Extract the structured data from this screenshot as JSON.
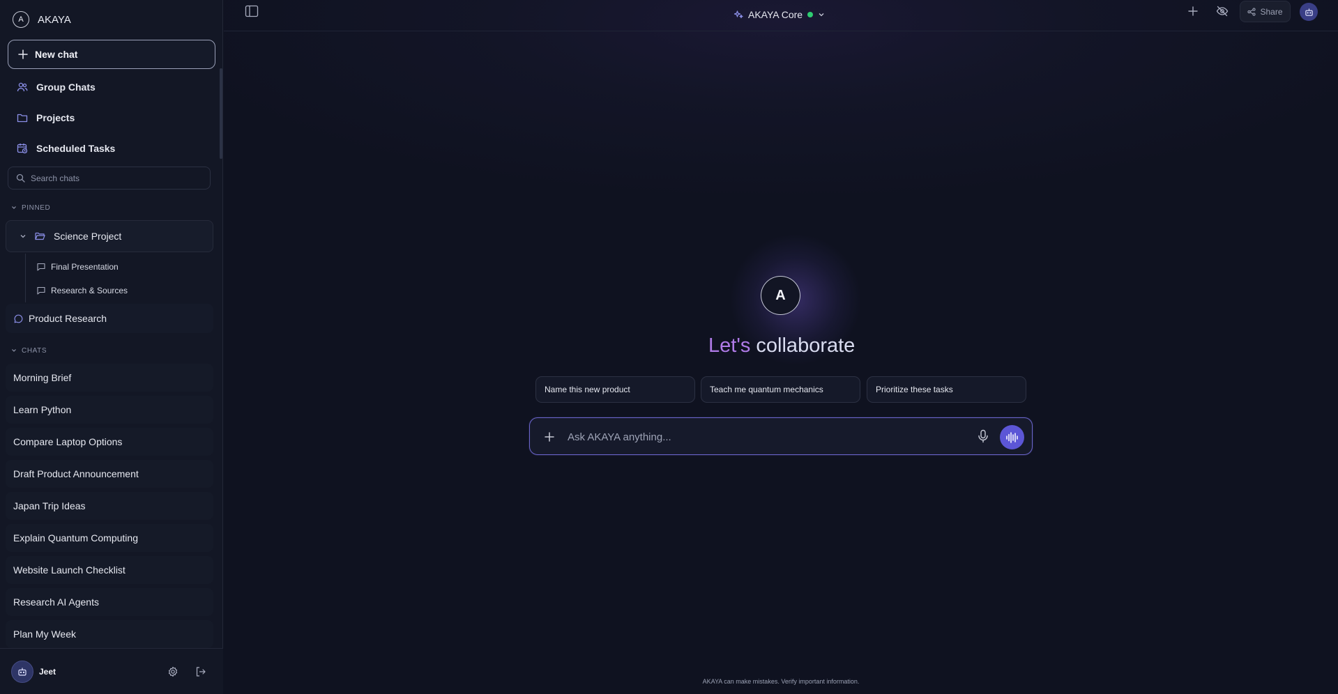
{
  "colors": {
    "accent": "#5c56d6",
    "status_online": "#2ecc71",
    "title_highlight": "#b07be8"
  },
  "sidebar": {
    "brand": {
      "logo_letter": "A",
      "name": "AKAYA"
    },
    "new_chat_label": "New chat",
    "nav": [
      {
        "label": "Group Chats",
        "icon": "users-icon"
      },
      {
        "label": "Projects",
        "icon": "folder-icon"
      },
      {
        "label": "Scheduled Tasks",
        "icon": "calendar-clock-icon"
      }
    ],
    "search": {
      "placeholder": "Search chats",
      "value": ""
    },
    "pinned": {
      "label": "PINNED",
      "folder": {
        "label": "Science Project",
        "items": [
          {
            "label": "Final Presentation"
          },
          {
            "label": "Research & Sources"
          }
        ]
      },
      "chat": {
        "label": "Product Research"
      }
    },
    "chats": {
      "label": "CHATS",
      "items": [
        {
          "label": "Morning Brief"
        },
        {
          "label": "Learn Python"
        },
        {
          "label": "Compare Laptop Options"
        },
        {
          "label": "Draft Product Announcement"
        },
        {
          "label": "Japan Trip Ideas"
        },
        {
          "label": "Explain Quantum Computing"
        },
        {
          "label": "Website Launch Checklist"
        },
        {
          "label": "Research AI Agents"
        },
        {
          "label": "Plan My Week"
        }
      ]
    },
    "user": {
      "name": "Jeet"
    }
  },
  "header": {
    "model_name": "AKAYA Core",
    "share_label": "Share"
  },
  "hero": {
    "logo_letter": "A",
    "title_part1": "Let's",
    "title_part2": "collaborate"
  },
  "suggestions": [
    {
      "label": "Name this new product"
    },
    {
      "label": "Teach me quantum mechanics"
    },
    {
      "label": "Prioritize these tasks"
    }
  ],
  "composer": {
    "placeholder": "Ask AKAYA anything...",
    "value": ""
  },
  "footer": {
    "disclaimer": "AKAYA can make mistakes. Verify important information."
  }
}
